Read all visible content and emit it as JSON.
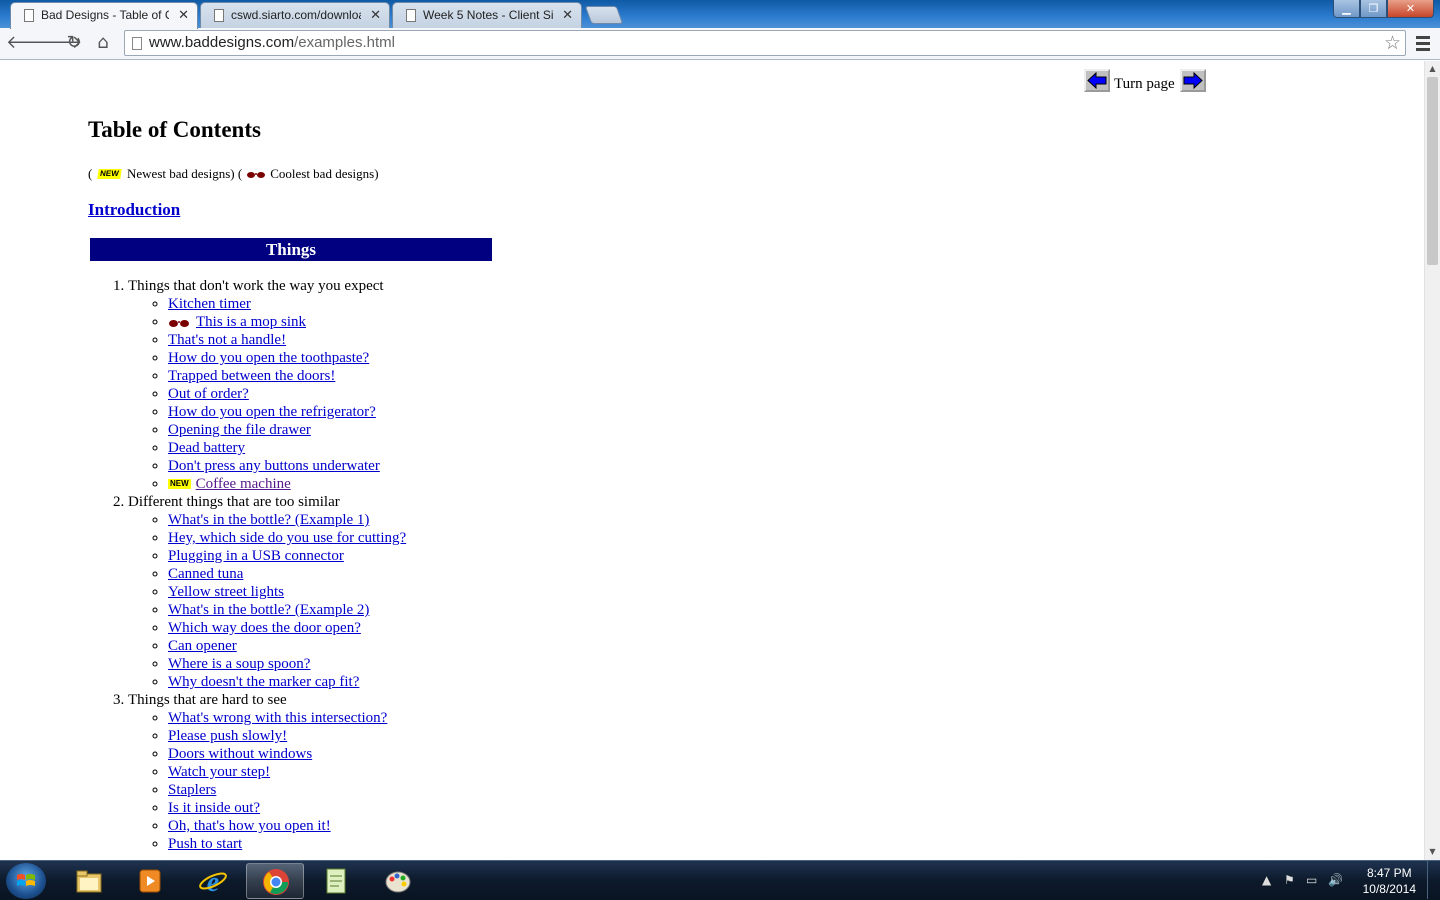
{
  "browser": {
    "tabs": [
      {
        "title": "Bad Designs - Table of Co",
        "active": true
      },
      {
        "title": "cswd.siarto.com/downloa",
        "active": false
      },
      {
        "title": "Week 5 Notes - Client Side",
        "active": false
      }
    ],
    "url_domain": "www.baddesigns.com",
    "url_path": "/examples.html"
  },
  "page": {
    "turn_page_label": "Turn page",
    "title": "Table of Contents",
    "legend": {
      "open_paren": "(",
      "new_badge": "NEW",
      "newest_label": "Newest bad designs)",
      "mid_paren": " (",
      "coolest_label": "Coolest bad designs)"
    },
    "intro_link": "Introduction",
    "section_banner": "Things",
    "sections": [
      {
        "heading": "Things that don't work the way you expect",
        "items": [
          {
            "label": "Kitchen timer"
          },
          {
            "label": "This is a mop sink",
            "marker": "cool"
          },
          {
            "label": "That's not a handle!"
          },
          {
            "label": "How do you open the toothpaste?"
          },
          {
            "label": "Trapped between the doors!"
          },
          {
            "label": "Out of order?"
          },
          {
            "label": "How do you open the refrigerator?"
          },
          {
            "label": "Opening the file drawer"
          },
          {
            "label": "Dead battery"
          },
          {
            "label": "Don't press any buttons underwater"
          },
          {
            "label": "Coffee machine",
            "marker": "new",
            "visited": true
          }
        ]
      },
      {
        "heading": "Different things that are too similar",
        "items": [
          {
            "label": "What's in the bottle? (Example 1)"
          },
          {
            "label": "Hey, which side do you use for cutting?"
          },
          {
            "label": "Plugging in a USB connector"
          },
          {
            "label": "Canned tuna"
          },
          {
            "label": "Yellow street lights"
          },
          {
            "label": "What's in the bottle? (Example 2)"
          },
          {
            "label": "Which way does the door open?"
          },
          {
            "label": "Can opener"
          },
          {
            "label": "Where is a soup spoon?"
          },
          {
            "label": "Why doesn't the marker cap fit?"
          }
        ]
      },
      {
        "heading": "Things that are hard to see",
        "items": [
          {
            "label": "What's wrong with this intersection?"
          },
          {
            "label": "Please push slowly!"
          },
          {
            "label": "Doors without windows"
          },
          {
            "label": "Watch your step!"
          },
          {
            "label": "Staplers"
          },
          {
            "label": "Is it inside out?"
          },
          {
            "label": "Oh, that's how you open it!"
          },
          {
            "label": "Push to start"
          }
        ]
      }
    ]
  },
  "taskbar": {
    "time": "8:47 PM",
    "date": "10/8/2014"
  },
  "colors": {
    "link": "#0000cc",
    "visited_link": "#551a8b",
    "banner_bg": "#000080",
    "new_badge_bg": "#ffff00"
  }
}
